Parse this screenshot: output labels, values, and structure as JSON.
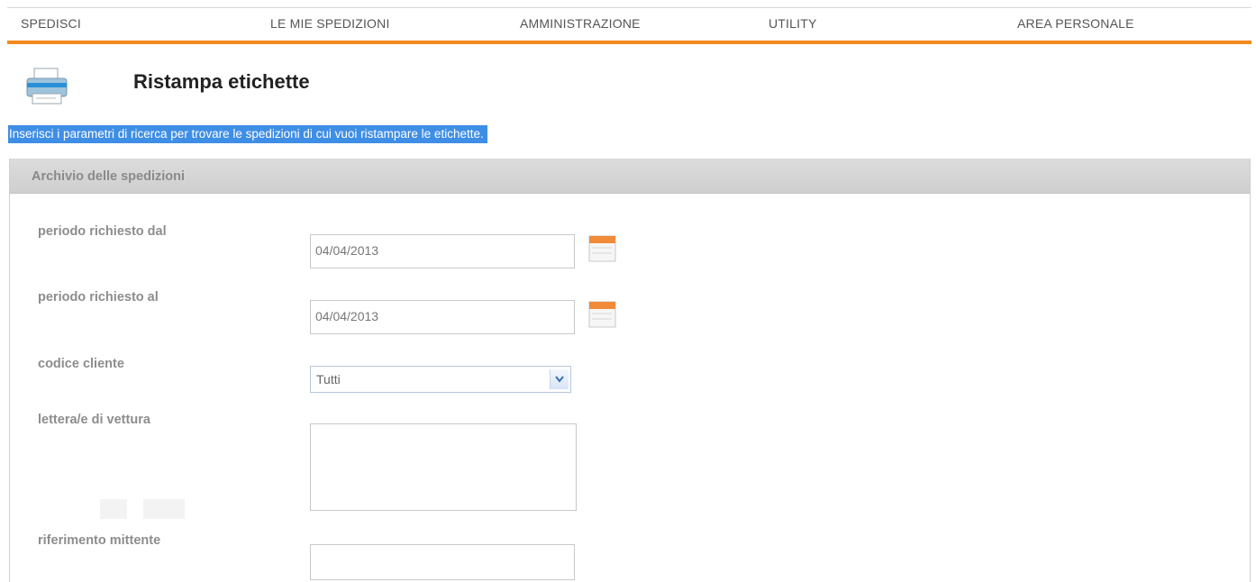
{
  "nav": {
    "items": [
      "SPEDISCI",
      "LE MIE SPEDIZIONI",
      "AMMINISTRAZIONE",
      "UTILITY",
      "AREA PERSONALE"
    ],
    "accent_color": "#f28a1c"
  },
  "page": {
    "icon": "printer-icon",
    "title": "Ristampa etichette",
    "instruction": "Inserisci i parametri di ricerca per trovare le spedizioni di cui vuoi ristampare le etichette."
  },
  "form": {
    "header": "Archivio delle spedizioni",
    "from_label": "periodo richiesto dal",
    "from_value": "04/04/2013",
    "to_label": "periodo richiesto al",
    "to_value": "04/04/2013",
    "customer_label": "codice cliente",
    "customer_value": "Tutti",
    "waybill_label": "lettera/e di vettura",
    "waybill_value": "",
    "sender_ref_label": "riferimento mittente",
    "sender_ref_value": "",
    "calendar_icon": "calendar-icon"
  }
}
